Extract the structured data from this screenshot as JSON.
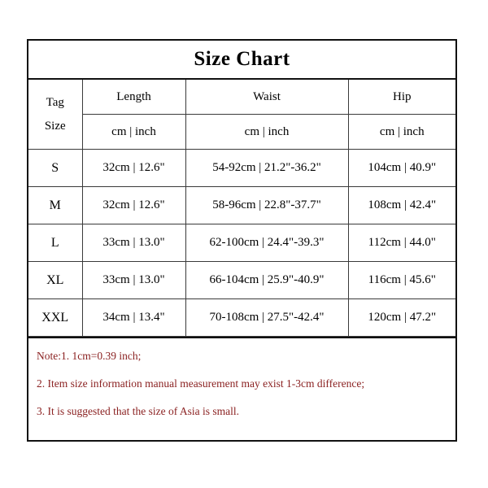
{
  "chart": {
    "title": "Size Chart",
    "tag_size_label_line1": "Tag",
    "tag_size_label_line2": "Size",
    "column_groups": [
      "Length",
      "Waist",
      "Hip"
    ],
    "unit_headers": [
      "cm | inch",
      "cm | inch",
      "cm | inch"
    ],
    "rows": [
      {
        "size": "S",
        "length": "32cm | 12.6\"",
        "waist": "54-92cm | 21.2\"-36.2\"",
        "hip": "104cm | 40.9\""
      },
      {
        "size": "M",
        "length": "32cm | 12.6\"",
        "waist": "58-96cm | 22.8\"-37.7\"",
        "hip": "108cm | 42.4\""
      },
      {
        "size": "L",
        "length": "33cm | 13.0\"",
        "waist": "62-100cm | 24.4\"-39.3\"",
        "hip": "112cm | 44.0\""
      },
      {
        "size": "XL",
        "length": "33cm | 13.0\"",
        "waist": "66-104cm | 25.9\"-40.9\"",
        "hip": "116cm | 45.6\""
      },
      {
        "size": "XXL",
        "length": "34cm | 13.4\"",
        "waist": "70-108cm | 27.5\"-42.4\"",
        "hip": "120cm | 47.2\""
      }
    ],
    "notes": [
      "Note:1.    1cm=0.39 inch;",
      "2.  Item size information manual measurement may exist 1-3cm difference;",
      "3.  It is suggested that the size of Asia is small."
    ],
    "colors": {
      "text": "#000000",
      "note_text": "#8B2222",
      "border": "#111111",
      "inner_border": "#3a3a3a",
      "background": "#ffffff"
    }
  }
}
